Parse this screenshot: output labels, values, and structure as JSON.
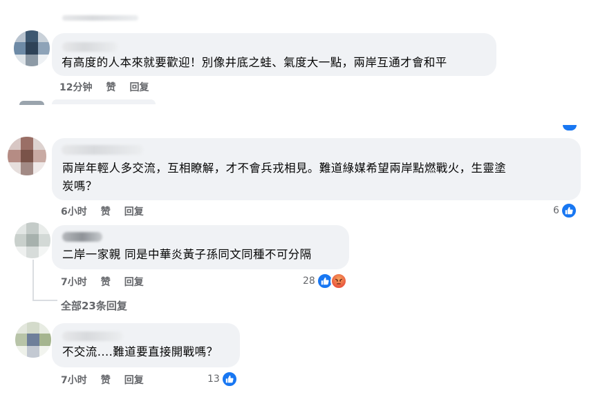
{
  "comments": [
    {
      "id": "c1",
      "text_lines": [
        "有高度的人本來就要歡迎！別像井底之蛙、氣度大一點，兩岸互通才會和平"
      ],
      "time": "12分钟",
      "like_label": "赞",
      "reply_label": "回复"
    },
    {
      "id": "c2",
      "text_lines": [
        "兩岸年輕人多交流，互相瞭解，才不會兵戎相見。難道綠媒希望兩岸點燃戰火，生靈塗",
        "炭嗎？"
      ],
      "time": "6小时",
      "like_label": "赞",
      "reply_label": "回复",
      "reaction_count": "6",
      "reactions": [
        "like"
      ]
    },
    {
      "id": "c3",
      "text_lines": [
        "二岸一家親 同是中華炎黃子孫同文同種不可分隔"
      ],
      "time": "7小时",
      "like_label": "赞",
      "reply_label": "回复",
      "reaction_count": "28",
      "reactions": [
        "like",
        "angry"
      ]
    },
    {
      "id": "c4",
      "text_lines": [
        "不交流....難道要直接開戰嗎？"
      ],
      "time": "7小时",
      "like_label": "赞",
      "reply_label": "回复",
      "reaction_count": "13",
      "reactions": [
        "like"
      ]
    }
  ],
  "view_replies_label": "全部23条回复",
  "colors": {
    "bubble": "#f0f2f5",
    "meta_text": "#65676b",
    "like_blue": "#1877f2",
    "angry_orange": "#e9573f"
  },
  "icons": {
    "like": "thumbs-up-icon",
    "angry": "angry-face-icon"
  }
}
